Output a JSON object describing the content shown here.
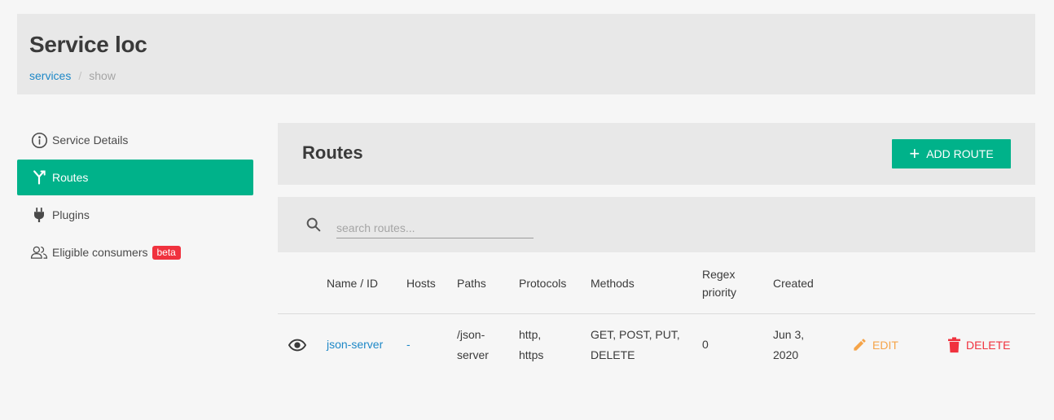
{
  "page": {
    "title": "Service loc",
    "breadcrumb": {
      "link": "services",
      "separator": "/",
      "current": "show"
    }
  },
  "sidebar": {
    "items": [
      {
        "label": "Service Details",
        "icon": "info-icon",
        "active": false
      },
      {
        "label": "Routes",
        "icon": "routes-icon",
        "active": true
      },
      {
        "label": "Plugins",
        "icon": "plug-icon",
        "active": false
      },
      {
        "label": "Eligible consumers",
        "icon": "users-icon",
        "active": false,
        "badge": "beta"
      }
    ]
  },
  "routes": {
    "title": "Routes",
    "add_button": "ADD ROUTE",
    "search_placeholder": "search routes...",
    "columns": [
      "Name / ID",
      "Hosts",
      "Paths",
      "Protocols",
      "Methods",
      "Regex priority",
      "Created"
    ],
    "rows": [
      {
        "name": "json-server",
        "hosts": "-",
        "paths": "/json-server",
        "protocols": "http, https",
        "methods": "GET, POST, PUT, DELETE",
        "regex_priority": "0",
        "created": "Jun 3, 2020",
        "edit_label": "EDIT",
        "delete_label": "DELETE"
      }
    ]
  },
  "colors": {
    "accent": "#00b28a",
    "link": "#1e88c7",
    "edit": "#f5a449",
    "danger": "#f0323e",
    "panel": "#e8e8e8"
  }
}
